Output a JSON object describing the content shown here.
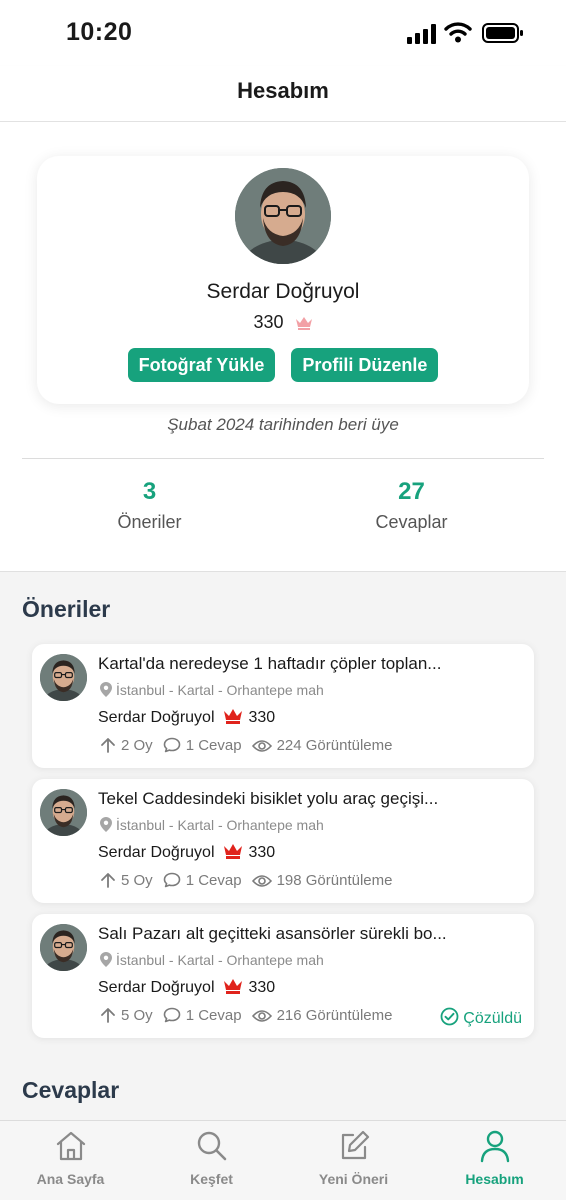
{
  "status_bar": {
    "time": "10:20"
  },
  "header": {
    "title": "Hesabım"
  },
  "profile": {
    "name": "Serdar Doğruyol",
    "points": "330",
    "upload_photo_label": "Fotoğraf Yükle",
    "edit_profile_label": "Profili Düzenle",
    "member_since": "Şubat 2024 tarihinden beri üye"
  },
  "stats": [
    {
      "value": "3",
      "label": "Öneriler"
    },
    {
      "value": "27",
      "label": "Cevaplar"
    }
  ],
  "sections": {
    "suggestions_title": "Öneriler",
    "answers_title": "Cevaplar"
  },
  "posts": [
    {
      "title": "Kartal'da neredeyse 1 haftadır çöpler toplan...",
      "location": "İstanbul - Kartal - Orhantepe mah",
      "author": "Serdar Doğruyol",
      "author_points": "330",
      "votes": "2 Oy",
      "answers": "1 Cevap",
      "views": "224 Görüntüleme",
      "solved": ""
    },
    {
      "title": "Tekel Caddesindeki bisiklet yolu araç geçişi...",
      "location": "İstanbul - Kartal - Orhantepe mah",
      "author": "Serdar Doğruyol",
      "author_points": "330",
      "votes": "5 Oy",
      "answers": "1 Cevap",
      "views": "198 Görüntüleme",
      "solved": ""
    },
    {
      "title": "Salı Pazarı alt geçitteki asansörler sürekli bo...",
      "location": "İstanbul - Kartal - Orhantepe mah",
      "author": "Serdar Doğruyol",
      "author_points": "330",
      "votes": "5 Oy",
      "answers": "1 Cevap",
      "views": "216 Görüntüleme",
      "solved": "Çözüldü"
    }
  ],
  "tabs": [
    {
      "label": "Ana Sayfa",
      "icon": "home-icon"
    },
    {
      "label": "Keşfet",
      "icon": "search-icon"
    },
    {
      "label": "Yeni Öneri",
      "icon": "edit-icon"
    },
    {
      "label": "Hesabım",
      "icon": "user-icon",
      "active": true
    }
  ],
  "colors": {
    "accent": "#17a27d",
    "crown_large": "#e0231c",
    "crown_small": "#f2a0a5",
    "section_title": "#2c3a4b"
  }
}
